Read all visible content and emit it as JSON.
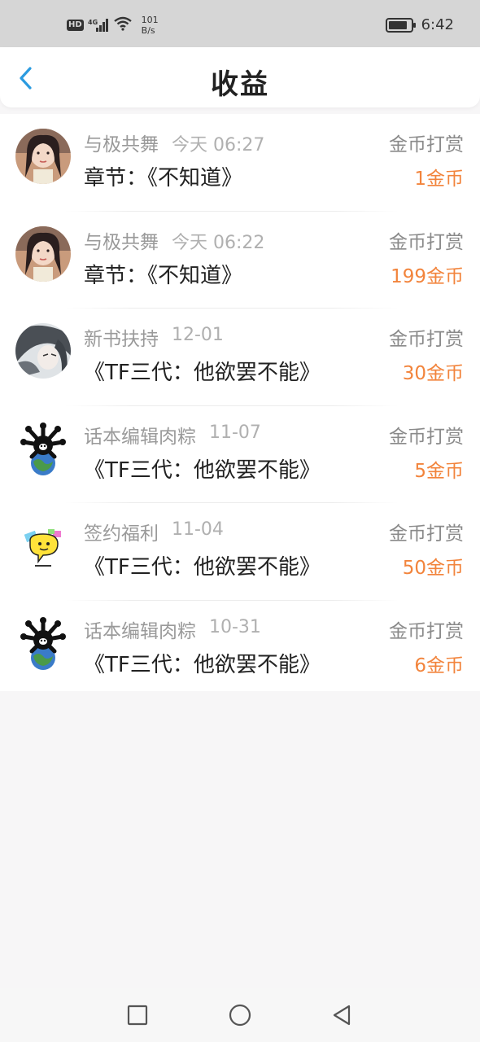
{
  "status": {
    "hd": "HD",
    "signal": "4G",
    "net_speed_value": "101",
    "net_speed_unit": "B/s",
    "battery_level": 0.85,
    "time": "6:42"
  },
  "header": {
    "title": "收益",
    "back_icon": "chevron-left-icon",
    "accent_color": "#2b9be0"
  },
  "rewards": [
    {
      "author": "与极共舞",
      "time": "今天 06:27",
      "type": "金币打赏",
      "chapter": "章节：《不知道》",
      "amount": "1金币",
      "avatar": "girl-photo-avatar"
    },
    {
      "author": "与极共舞",
      "time": "今天 06:22",
      "type": "金币打赏",
      "chapter": "章节：《不知道》",
      "amount": "199金币",
      "avatar": "girl-photo-avatar"
    },
    {
      "author": "新书扶持",
      "time": "12-01",
      "type": "金币打赏",
      "chapter": "《TF三代：他欲罢不能》",
      "amount": "30金币",
      "avatar": "anime-character-avatar"
    },
    {
      "author": "话本编辑肉粽",
      "time": "11-07",
      "type": "金币打赏",
      "chapter": "《TF三代：他欲罢不能》",
      "amount": "5金币",
      "avatar": "earth-cartoon-avatar"
    },
    {
      "author": "签约福利",
      "time": "11-04",
      "type": "金币打赏",
      "chapter": "《TF三代：他欲罢不能》",
      "amount": "50金币",
      "avatar": "chat-bubble-avatar"
    },
    {
      "author": "话本编辑肉粽",
      "time": "10-31",
      "type": "金币打赏",
      "chapter": "《TF三代：他欲罢不能》",
      "amount": "6金币",
      "avatar": "earth-cartoon-avatar"
    }
  ],
  "colors": {
    "amount": "#f2843c",
    "meta": "#9a9a9a",
    "background": "#f7f6f7"
  },
  "navbar": {
    "recent_icon": "square-icon",
    "home_icon": "circle-icon",
    "back_icon": "triangle-back-icon"
  }
}
